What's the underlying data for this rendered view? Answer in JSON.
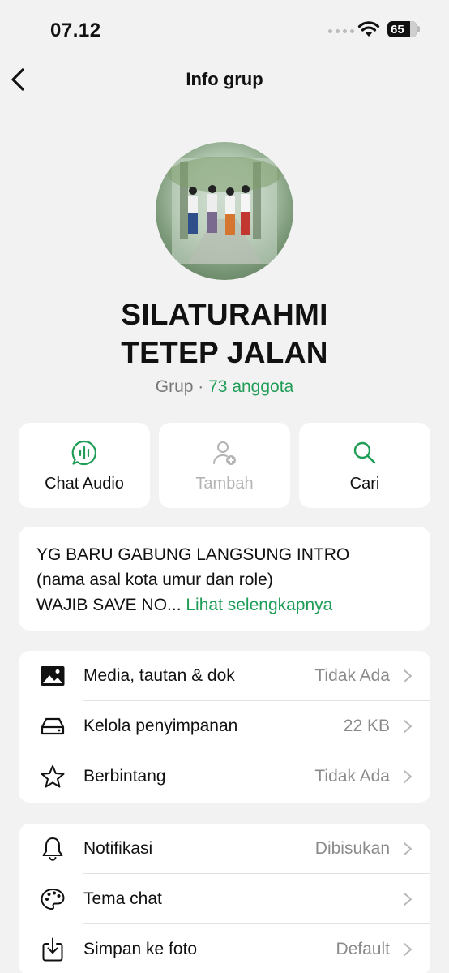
{
  "status": {
    "time": "07.12",
    "battery": "65"
  },
  "nav": {
    "title": "Info grup"
  },
  "group": {
    "name_line1": "SILATURAHMI",
    "name_line2": "TETEP JALAN",
    "type": "Grup",
    "separator": " · ",
    "members": "73 anggota"
  },
  "actions": [
    {
      "label": "Chat Audio",
      "icon": "audio-chat-icon",
      "enabled": true
    },
    {
      "label": "Tambah",
      "icon": "add-person-icon",
      "enabled": false
    },
    {
      "label": "Cari",
      "icon": "search-icon",
      "enabled": true
    }
  ],
  "description": {
    "line1": "YG BARU GABUNG LANGSUNG INTRO",
    "line2": "(nama asal kota umur dan role)",
    "line3": "WAJIB SAVE NO... ",
    "more": "Lihat selengkapnya"
  },
  "section1": [
    {
      "label": "Media, tautan & dok",
      "value": "Tidak Ada",
      "icon": "image-icon"
    },
    {
      "label": "Kelola penyimpanan",
      "value": "22 KB",
      "icon": "storage-icon"
    },
    {
      "label": "Berbintang",
      "value": "Tidak Ada",
      "icon": "star-icon"
    }
  ],
  "section2": [
    {
      "label": "Notifikasi",
      "value": "Dibisukan",
      "icon": "bell-icon"
    },
    {
      "label": "Tema chat",
      "value": "",
      "icon": "palette-icon"
    },
    {
      "label": "Simpan ke foto",
      "value": "Default",
      "icon": "save-to-photos-icon"
    }
  ],
  "colors": {
    "accent": "#1f9d57",
    "background": "#f2f2f2",
    "card": "#ffffff"
  }
}
